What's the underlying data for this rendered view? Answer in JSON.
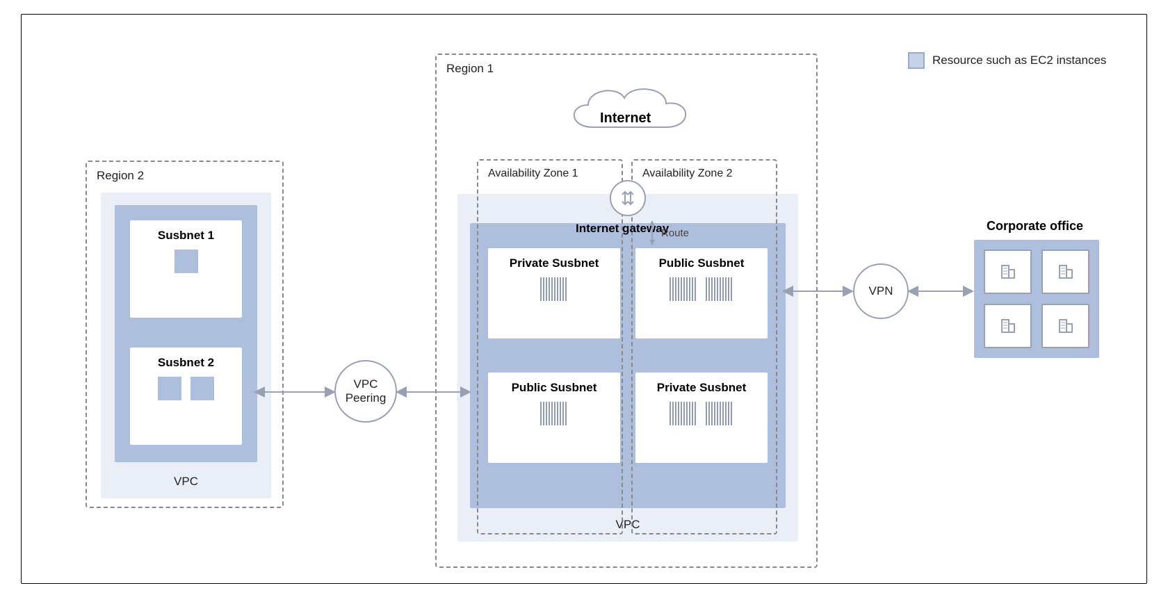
{
  "legend": {
    "text": "Resource such as EC2 instances"
  },
  "region2": {
    "label": "Region 2",
    "vpc_label": "VPC",
    "subnet1": {
      "title": "Susbnet 1",
      "resources": 1
    },
    "subnet2": {
      "title": "Susbnet 2",
      "resources": 2
    }
  },
  "region1": {
    "label": "Region 1",
    "internet_label": "Internet",
    "igw_label": "Internet gateway",
    "route_label": "Route",
    "vpc_label": "VPC",
    "az1": {
      "label": "Availability Zone 1"
    },
    "az2": {
      "label": "Availability Zone 2"
    },
    "subnets": {
      "az1_top": {
        "title": "Private Susbnet",
        "resources": 1
      },
      "az1_bottom": {
        "title": "Public Susbnet",
        "resources": 1
      },
      "az2_top": {
        "title": "Public Susbnet",
        "resources": 2
      },
      "az2_bottom": {
        "title": "Private Susbnet",
        "resources": 2
      }
    }
  },
  "nodes": {
    "vpc_peering": "VPC\nPeering",
    "vpn": "VPN"
  },
  "corporate": {
    "title": "Corporate office"
  }
}
